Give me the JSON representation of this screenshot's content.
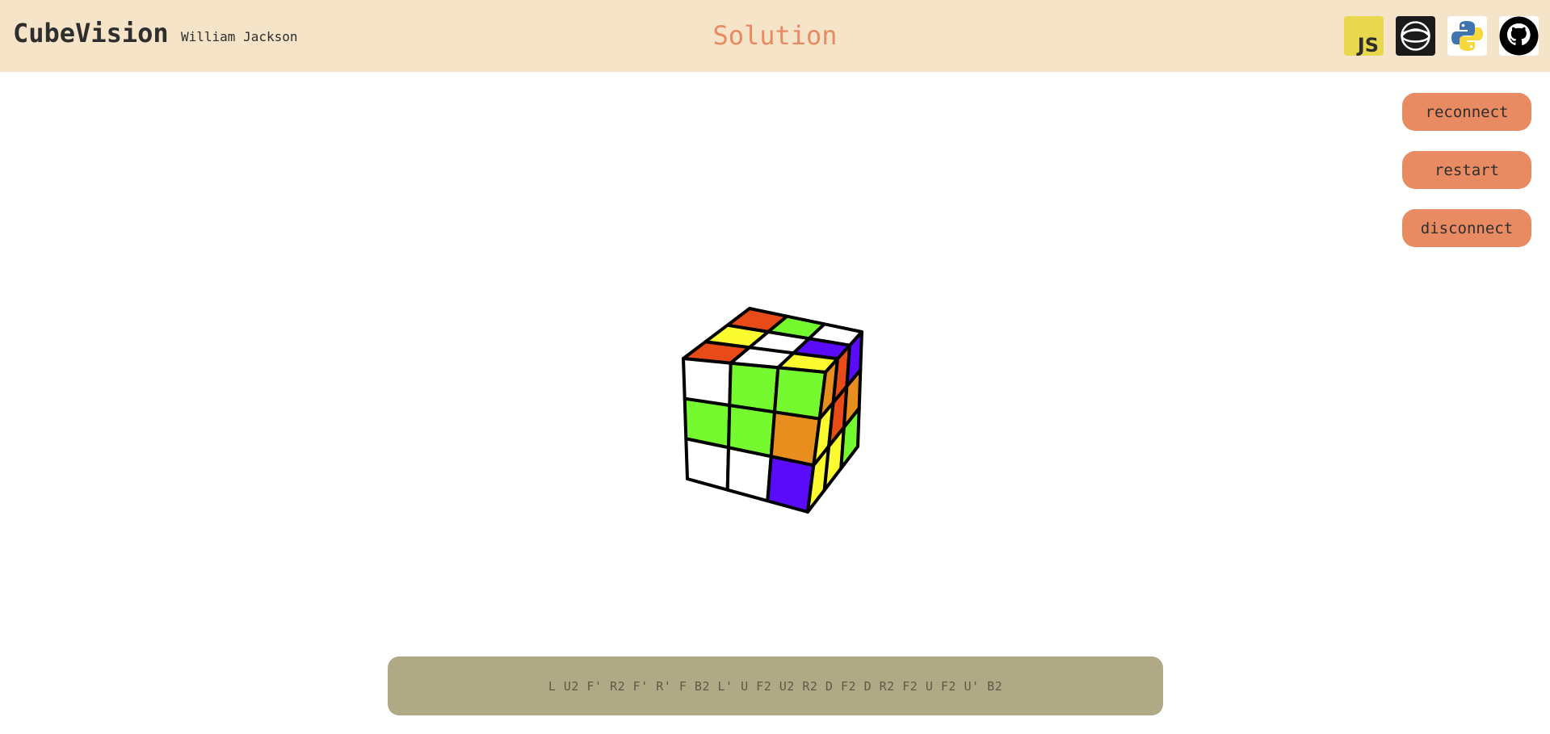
{
  "header": {
    "brand": "CubeVision",
    "author": "William Jackson",
    "title": "Solution",
    "icons": [
      {
        "name": "javascript-icon",
        "label": "JS",
        "bg": "#e8d84e"
      },
      {
        "name": "threejs-icon",
        "bg": "#1a1a1a"
      },
      {
        "name": "python-icon",
        "bg": "#ffffff"
      },
      {
        "name": "github-icon",
        "bg": "#ffffff"
      }
    ]
  },
  "controls": {
    "reconnect": "reconnect",
    "restart": "restart",
    "disconnect": "disconnect"
  },
  "cube": {
    "top_face": [
      [
        "red",
        "green",
        "white"
      ],
      [
        "yellow",
        "white",
        "blue"
      ],
      [
        "red",
        "white",
        "yellow"
      ]
    ],
    "front_face": [
      [
        "white",
        "green",
        "green"
      ],
      [
        "green",
        "green",
        "orange"
      ],
      [
        "white",
        "white",
        "blue"
      ]
    ],
    "right_face": [
      [
        "orange",
        "red",
        "blue"
      ],
      [
        "yellow",
        "red",
        "orange"
      ],
      [
        "yellow",
        "yellow",
        "green"
      ]
    ],
    "colors": {
      "white": "#ffffff",
      "green": "#74fa2e",
      "red": "#e84a18",
      "yellow": "#fbfb30",
      "blue": "#5a0cfa",
      "orange": "#e88e1e"
    }
  },
  "solution": {
    "moves": "L U2 F' R2 F' R' F B2 L' U F2 U2 R2 D F2 D R2 F2 U F2 U' B2"
  },
  "theme": {
    "header_bg": "#f5e4c8",
    "accent": "#e88b62",
    "solution_bg": "#b0a985"
  }
}
